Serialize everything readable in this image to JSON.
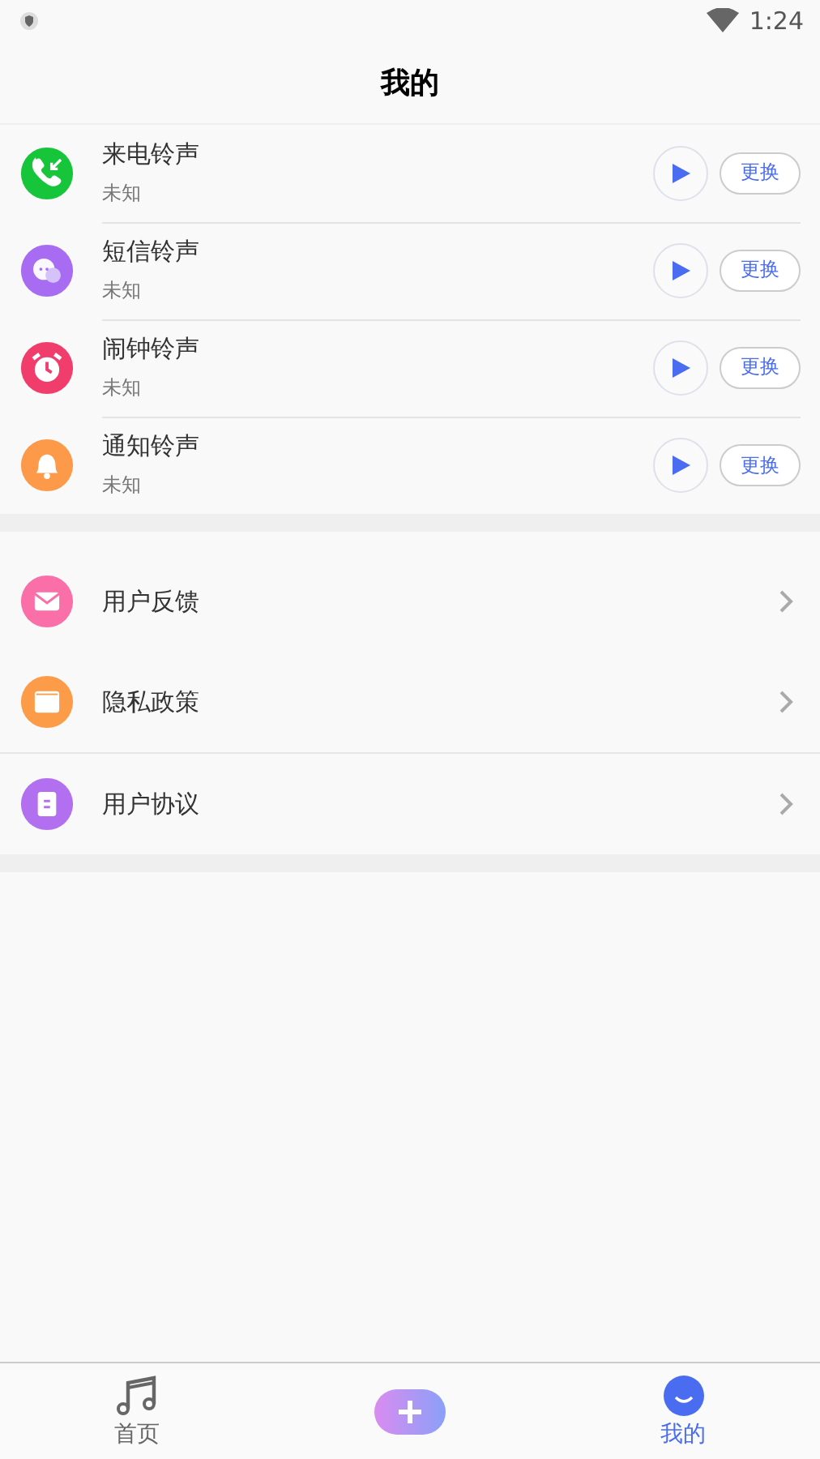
{
  "status_bar": {
    "time": "1:24"
  },
  "header": {
    "title": "我的"
  },
  "ringtones": [
    {
      "name": "来电铃声",
      "value": "未知",
      "action": "更换"
    },
    {
      "name": "短信铃声",
      "value": "未知",
      "action": "更换"
    },
    {
      "name": "闹钟铃声",
      "value": "未知",
      "action": "更换"
    },
    {
      "name": "通知铃声",
      "value": "未知",
      "action": "更换"
    }
  ],
  "menu": [
    {
      "label": "用户反馈"
    },
    {
      "label": "隐私政策"
    },
    {
      "label": "用户协议"
    }
  ],
  "tab_bar": [
    {
      "label": "首页",
      "selected": false
    },
    {
      "label": "我的",
      "selected": true
    }
  ]
}
